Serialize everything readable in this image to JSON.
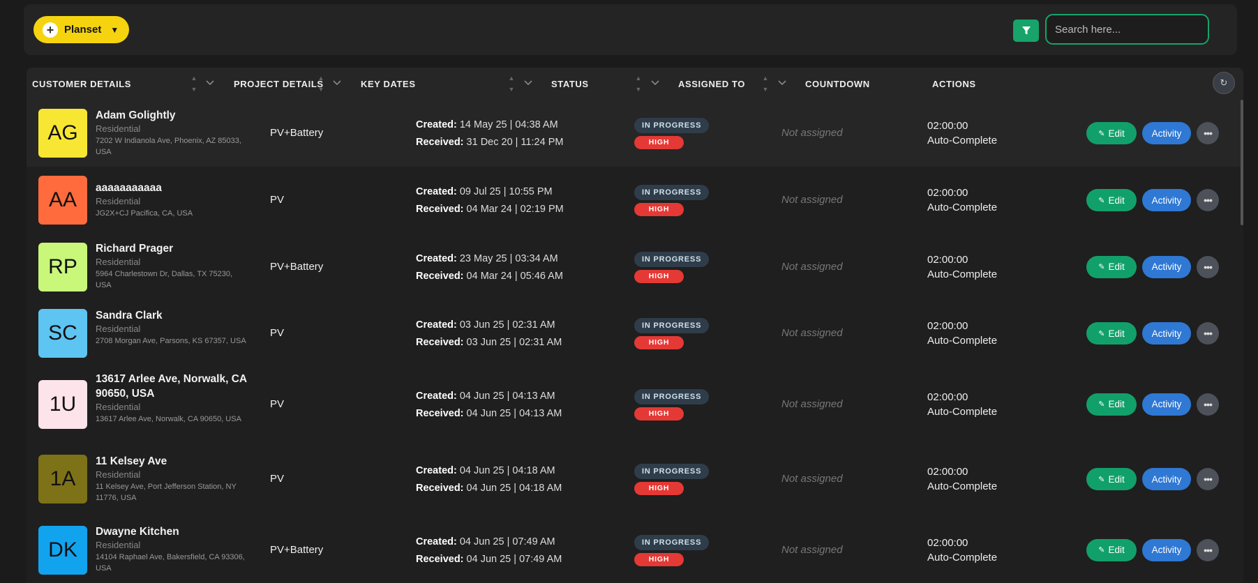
{
  "toolbar": {
    "planset_label": "Planset",
    "search_placeholder": "Search here..."
  },
  "table": {
    "headers": [
      "CUSTOMER DETAILS",
      "PROJECT DETAILS",
      "KEY DATES",
      "STATUS",
      "ASSIGNED TO",
      "COUNTDOWN",
      "ACTIONS"
    ],
    "labels": {
      "created": "Created:",
      "received": "Received:",
      "edit": "Edit",
      "activity": "Activity"
    },
    "rows": [
      {
        "initials": "AG",
        "avatar_color": "#f7e733",
        "name": "Adam Golightly",
        "type": "Residential",
        "address": "7202 W Indianola Ave, Phoenix, AZ 85033, USA",
        "project": "PV+Battery",
        "created": "14 May 25 | 04:38 AM",
        "received": "31 Dec 20 | 11:24 PM",
        "status": "IN PROGRESS",
        "priority": "HIGH",
        "assigned": "Not assigned",
        "countdown": "02:00:00",
        "countdown_mode": "Auto-Complete"
      },
      {
        "initials": "AA",
        "avatar_color": "#ff6b3d",
        "name": "aaaaaaaaaaa",
        "type": "Residential",
        "address": "JG2X+CJ Pacifica, CA, USA",
        "project": "PV",
        "created": "09 Jul 25 | 10:55 PM",
        "received": "04 Mar 24 | 02:19 PM",
        "status": "IN PROGRESS",
        "priority": "HIGH",
        "assigned": "Not assigned",
        "countdown": "02:00:00",
        "countdown_mode": "Auto-Complete"
      },
      {
        "initials": "RP",
        "avatar_color": "#c8f77a",
        "name": "Richard Prager",
        "type": "Residential",
        "address": "5964 Charlestown Dr, Dallas, TX 75230, USA",
        "project": "PV+Battery",
        "created": "23 May 25 | 03:34 AM",
        "received": "04 Mar 24 | 05:46 AM",
        "status": "IN PROGRESS",
        "priority": "HIGH",
        "assigned": "Not assigned",
        "countdown": "02:00:00",
        "countdown_mode": "Auto-Complete"
      },
      {
        "initials": "SC",
        "avatar_color": "#5ec4f2",
        "name": "Sandra Clark",
        "type": "Residential",
        "address": "2708 Morgan Ave, Parsons, KS 67357, USA",
        "project": "PV",
        "created": "03 Jun 25 | 02:31 AM",
        "received": "03 Jun 25 | 02:31 AM",
        "status": "IN PROGRESS",
        "priority": "HIGH",
        "assigned": "Not assigned",
        "countdown": "02:00:00",
        "countdown_mode": "Auto-Complete"
      },
      {
        "initials": "1U",
        "avatar_color": "#fde3ea",
        "name": "13617 Arlee Ave, Norwalk, CA 90650, USA",
        "type": "Residential",
        "address": "13617 Arlee Ave, Norwalk, CA 90650, USA",
        "project": "PV",
        "created": "04 Jun 25 | 04:13 AM",
        "received": "04 Jun 25 | 04:13 AM",
        "status": "IN PROGRESS",
        "priority": "HIGH",
        "assigned": "Not assigned",
        "countdown": "02:00:00",
        "countdown_mode": "Auto-Complete"
      },
      {
        "initials": "1A",
        "avatar_color": "#7d7217",
        "name": "11 Kelsey Ave",
        "type": "Residential",
        "address": "11 Kelsey Ave, Port Jefferson Station, NY 11776, USA",
        "project": "PV",
        "created": "04 Jun 25 | 04:18 AM",
        "received": "04 Jun 25 | 04:18 AM",
        "status": "IN PROGRESS",
        "priority": "HIGH",
        "assigned": "Not assigned",
        "countdown": "02:00:00",
        "countdown_mode": "Auto-Complete"
      },
      {
        "initials": "DK",
        "avatar_color": "#12a3ef",
        "name": "Dwayne Kitchen",
        "type": "Residential",
        "address": "14104 Raphael Ave, Bakersfield, CA 93306, USA",
        "project": "PV+Battery",
        "created": "04 Jun 25 | 07:49 AM",
        "received": "04 Jun 25 | 07:49 AM",
        "status": "IN PROGRESS",
        "priority": "HIGH",
        "assigned": "Not assigned",
        "countdown": "02:00:00",
        "countdown_mode": "Auto-Complete"
      }
    ]
  },
  "colors": {
    "accent_yellow": "#f5d40f",
    "accent_green": "#12a06a",
    "accent_blue": "#2f78d4",
    "priority_red": "#e53935"
  }
}
